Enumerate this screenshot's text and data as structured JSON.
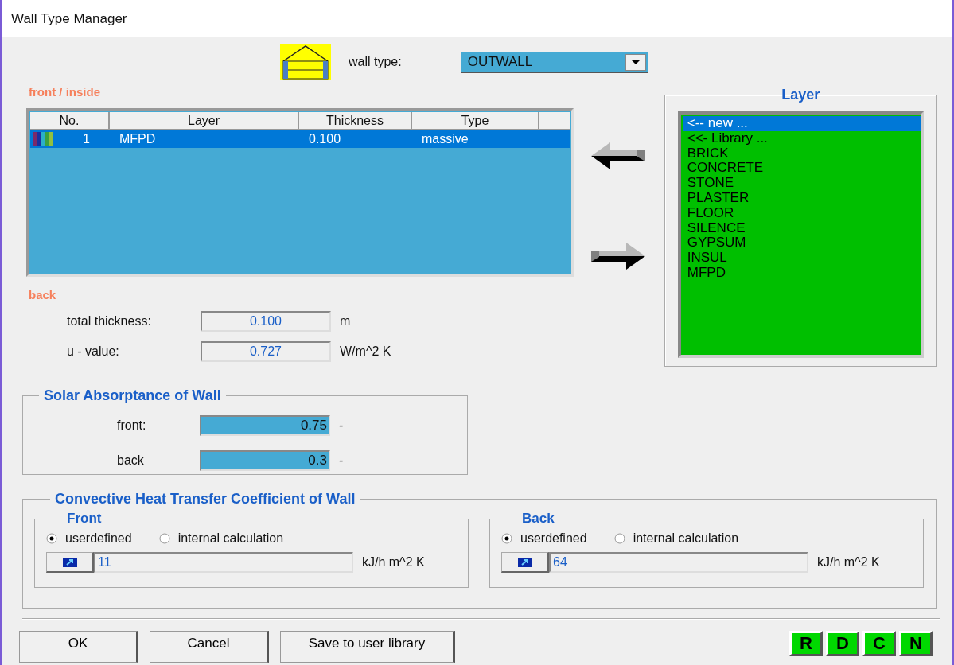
{
  "window": {
    "title": "Wall Type Manager"
  },
  "wall_type": {
    "label": "wall type:",
    "value": "OUTWALL"
  },
  "front_label": "front / inside",
  "layers_table": {
    "columns": [
      "No.",
      "Layer",
      "Thickness",
      "Type"
    ],
    "rows": [
      {
        "no": "1",
        "layer": "MFPD",
        "thickness": "0.100",
        "type": "massive",
        "selected": true
      }
    ]
  },
  "back_label": "back",
  "totals": [
    {
      "label": "total thickness:",
      "value": "0.100",
      "unit": "m"
    },
    {
      "label": "u - value:",
      "value": "0.727",
      "unit": "W/m^2 K"
    }
  ],
  "layer_library": {
    "title": "Layer",
    "items": [
      {
        "label": "<-- new ...",
        "selected": true
      },
      {
        "label": "<<- Library ...",
        "selected": false
      },
      {
        "label": "BRICK",
        "selected": false
      },
      {
        "label": "CONCRETE",
        "selected": false
      },
      {
        "label": "STONE",
        "selected": false
      },
      {
        "label": "PLASTER",
        "selected": false
      },
      {
        "label": "FLOOR",
        "selected": false
      },
      {
        "label": "SILENCE",
        "selected": false
      },
      {
        "label": "GYPSUM",
        "selected": false
      },
      {
        "label": "INSUL",
        "selected": false
      },
      {
        "label": "MFPD",
        "selected": false
      }
    ]
  },
  "solar_absorptance": {
    "title": "Solar Absorptance of Wall",
    "rows": [
      {
        "label": "front:",
        "value": "0.75",
        "unit": "-"
      },
      {
        "label": "back",
        "value": "0.3",
        "unit": "-"
      }
    ]
  },
  "convective": {
    "title": "Convective Heat Transfer Coefficient of Wall",
    "sides": [
      {
        "title": "Front",
        "options": [
          {
            "label": "userdefined",
            "selected": true
          },
          {
            "label": "internal calculation",
            "selected": false
          }
        ],
        "value": "11",
        "unit": "kJ/h m^2 K"
      },
      {
        "title": "Back",
        "options": [
          {
            "label": "userdefined",
            "selected": true
          },
          {
            "label": "internal calculation",
            "selected": false
          }
        ],
        "value": "64",
        "unit": "kJ/h m^2 K"
      }
    ]
  },
  "buttons": [
    "OK",
    "Cancel",
    "Save to user library"
  ],
  "mode_buttons": [
    "R",
    "D",
    "C",
    "N"
  ]
}
